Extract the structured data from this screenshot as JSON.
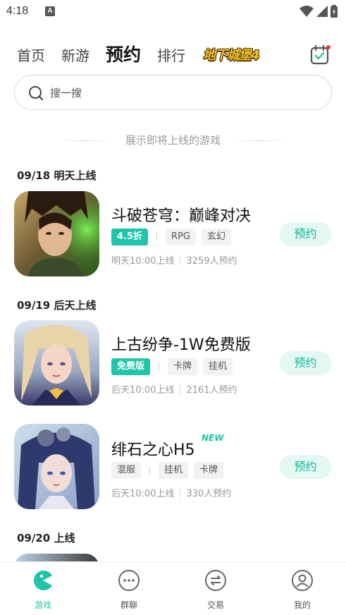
{
  "status": {
    "time": "4:18",
    "notif_letter": "A"
  },
  "tabs": [
    {
      "label": "首页"
    },
    {
      "label": "新游"
    },
    {
      "label": "预约",
      "active": true
    },
    {
      "label": "排行"
    }
  ],
  "banner_label": "地下城堡4",
  "search": {
    "placeholder": "搜一搜"
  },
  "section_caption": "展示即将上线的游戏",
  "dates": [
    "09/18 明天上线",
    "09/19 后天上线",
    "09/20 上线"
  ],
  "games": [
    {
      "title": "斗破苍穹：巅峰对决",
      "badge": "4.5折",
      "tags": [
        "RPG",
        "玄幻"
      ],
      "time": "明天10:00上线",
      "count": "3259人预约",
      "button": "预约"
    },
    {
      "title": "上古纷争-1W免费版",
      "badge": "免费版",
      "tags": [
        "卡牌",
        "挂机"
      ],
      "time": "后天10:00上线",
      "count": "2161人预约",
      "button": "预约"
    },
    {
      "title": "绯石之心H5",
      "new_label": "NEW",
      "tags": [
        "混服",
        "挂机",
        "卡牌"
      ],
      "time": "后天10:00上线",
      "count": "330人预约",
      "button": "预约"
    }
  ],
  "nav": [
    {
      "label": "游戏",
      "active": true
    },
    {
      "label": "群聊"
    },
    {
      "label": "交易"
    },
    {
      "label": "我的"
    }
  ],
  "colors": {
    "accent": "#1fc5a8",
    "reserve_bg": "#e3f7f3",
    "badge_dot": "#e53935"
  }
}
